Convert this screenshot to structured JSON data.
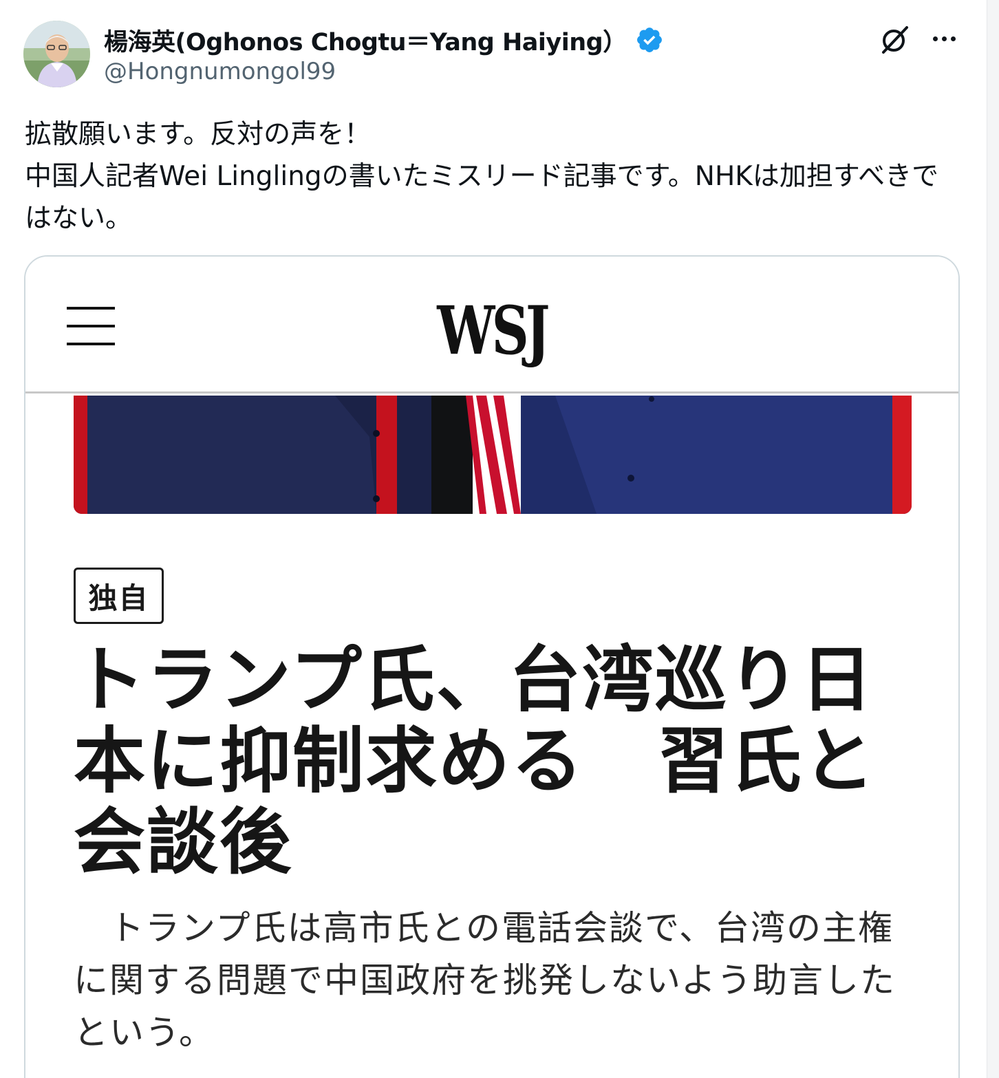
{
  "tweet": {
    "author": {
      "display_name": "楊海英(Oghonos Chogtu＝Yang Haiying）",
      "handle": "@Hongnumongol99",
      "verified": true,
      "verified_color": "#1d9bf0"
    },
    "icons": {
      "grok": "grok-icon",
      "more": "more-icon",
      "verified": "verified-badge-icon"
    },
    "text": "拡散願います。反対の声を！\n中国人記者Wei Linglingの書いたミスリード記事です。NHKは加担すべきではない。"
  },
  "card": {
    "site_logo": "WSJ",
    "badge": "独自",
    "headline": "トランプ氏、台湾巡り日本に抑制求める　習氏と会談後",
    "summary": "　トランプ氏は高市氏との電話会談で、台湾の主権に関する問題で中国政府を挑発しないよう助言したという。"
  },
  "colors": {
    "text_primary": "#0f1419",
    "text_secondary": "#536471",
    "card_border": "#cfd9de"
  }
}
